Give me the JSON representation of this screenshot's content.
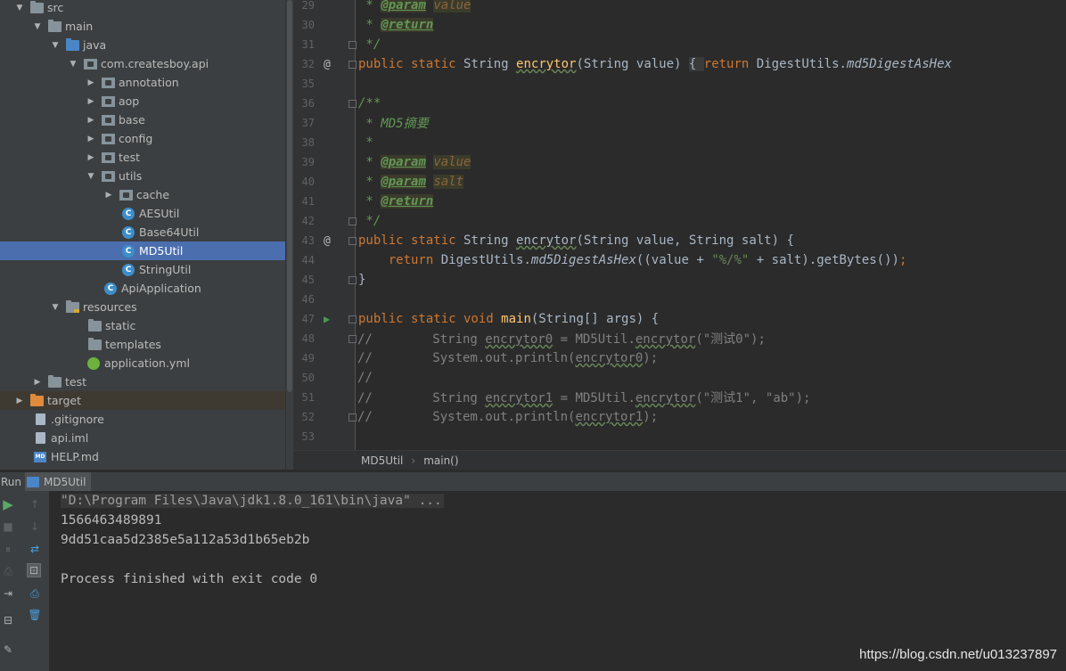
{
  "project_tree": [
    {
      "label": "src",
      "arrow": "▼",
      "icon": "folder"
    },
    {
      "label": "main",
      "arrow": "▼",
      "icon": "folder"
    },
    {
      "label": "java",
      "arrow": "▼",
      "icon": "source-folder"
    },
    {
      "label": "com.createsboy.api",
      "arrow": "▼",
      "icon": "package"
    },
    {
      "label": "annotation",
      "arrow": "▶",
      "icon": "package"
    },
    {
      "label": "aop",
      "arrow": "▶",
      "icon": "package"
    },
    {
      "label": "base",
      "arrow": "▶",
      "icon": "package"
    },
    {
      "label": "config",
      "arrow": "▶",
      "icon": "package"
    },
    {
      "label": "test",
      "arrow": "▶",
      "icon": "package"
    },
    {
      "label": "utils",
      "arrow": "▼",
      "icon": "package"
    },
    {
      "label": "cache",
      "arrow": "▶",
      "icon": "package"
    },
    {
      "label": "AESUtil",
      "icon": "class"
    },
    {
      "label": "Base64Util",
      "icon": "class"
    },
    {
      "label": "MD5Util",
      "icon": "class"
    },
    {
      "label": "StringUtil",
      "icon": "class"
    },
    {
      "label": "ApiApplication",
      "icon": "spring-class"
    },
    {
      "label": "resources",
      "arrow": "▼",
      "icon": "resources-folder"
    },
    {
      "label": "static",
      "icon": "folder"
    },
    {
      "label": "templates",
      "icon": "folder"
    },
    {
      "label": "application.yml",
      "icon": "spring-config"
    },
    {
      "label": "test",
      "arrow": "▶",
      "icon": "folder"
    },
    {
      "label": "target",
      "arrow": "▶",
      "icon": "excluded-folder"
    },
    {
      "label": ".gitignore",
      "icon": "file"
    },
    {
      "label": "api.iml",
      "icon": "file"
    },
    {
      "label": "HELP.md",
      "icon": "markdown",
      "icon_text": "MD"
    }
  ],
  "class_icon_letter": "C",
  "editor": {
    "line_numbers": [
      "29",
      "30",
      "31",
      "32",
      "35",
      "36",
      "37",
      "38",
      "39",
      "40",
      "41",
      "42",
      "43",
      "44",
      "45",
      "46",
      "47",
      "48",
      "49",
      "50",
      "51",
      "52",
      "53"
    ],
    "lines": {
      "l29_star": " * ",
      "l29_tag": "@param",
      "l29_sp": " ",
      "l29_arg": "value",
      "l30_star": " * ",
      "l30_tag": "@return",
      "l31": " */",
      "l32_mod": "public static ",
      "l32_type": "String ",
      "l32_name": "encrytor",
      "l32_sig": "(String value) ",
      "l32_fold": "{ ",
      "l32_ret": "return ",
      "l32_body": "DigestUtils.",
      "l32_call": "md5DigestAsHex",
      "l35": "",
      "l36": "/**",
      "l37_star": " * ",
      "l37_text": "MD5摘要",
      "l38": " *",
      "l39_star": " * ",
      "l39_tag": "@param",
      "l39_sp": " ",
      "l39_arg": "value",
      "l40_star": " * ",
      "l40_tag": "@param",
      "l40_sp": " ",
      "l40_arg": "salt",
      "l41_star": " * ",
      "l41_tag": "@return",
      "l42": " */",
      "l43_mod": "public static ",
      "l43_type": "String ",
      "l43_name": "encrytor",
      "l43_sig": "(String value, String salt) {",
      "l44_indent": "    ",
      "l44_ret": "return ",
      "l44_a": "DigestUtils.",
      "l44_call": "md5DigestAsHex",
      "l44_b": "((value + ",
      "l44_str": "\"%/%\"",
      "l44_c": " + salt).getBytes())",
      "l44_semi": ";",
      "l45": "}",
      "l46": "",
      "l47_mod": "public static void ",
      "l47_name": "main",
      "l47_sig": "(String[] args) {",
      "l48_c1": "//        String ",
      "l48_var": "encrytor0",
      "l48_c2": " = MD5Util.",
      "l48_call": "encrytor",
      "l48_c3": "(\"测试0\");",
      "l49_c1": "//        System.out.println(",
      "l49_var": "encrytor0",
      "l49_c2": ");",
      "l50": "//",
      "l51_c1": "//        String ",
      "l51_var": "encrytor1",
      "l51_c2": " = MD5Util.",
      "l51_call": "encrytor",
      "l51_c3": "(\"测试1\", \"ab\");",
      "l52_c1": "//        System.out.println(",
      "l52_var": "encrytor1",
      "l52_c2": ");",
      "l53": ""
    },
    "override_marker": "@",
    "run_marker": "▶"
  },
  "breadcrumbs": {
    "class": "MD5Util",
    "separator": "›",
    "method": "main()"
  },
  "run_panel": {
    "label": "Run",
    "tab": "MD5Util",
    "toolbar_left": [
      "▶",
      "■",
      "⏸",
      "⎙",
      "⇥",
      "⊟",
      "✎"
    ],
    "toolbar_right": [
      "↑",
      "↓",
      "⇄",
      "⊡",
      "⎙",
      "🗑"
    ]
  },
  "console": {
    "command": "\"D:\\Program Files\\Java\\jdk1.8.0_161\\bin\\java\" ...",
    "lines": [
      "1566463489891",
      "9dd51caa5d2385e5a112a53d1b65eb2b",
      "",
      "Process finished with exit code 0"
    ]
  },
  "watermark": "https://blog.csdn.net/u013237897"
}
